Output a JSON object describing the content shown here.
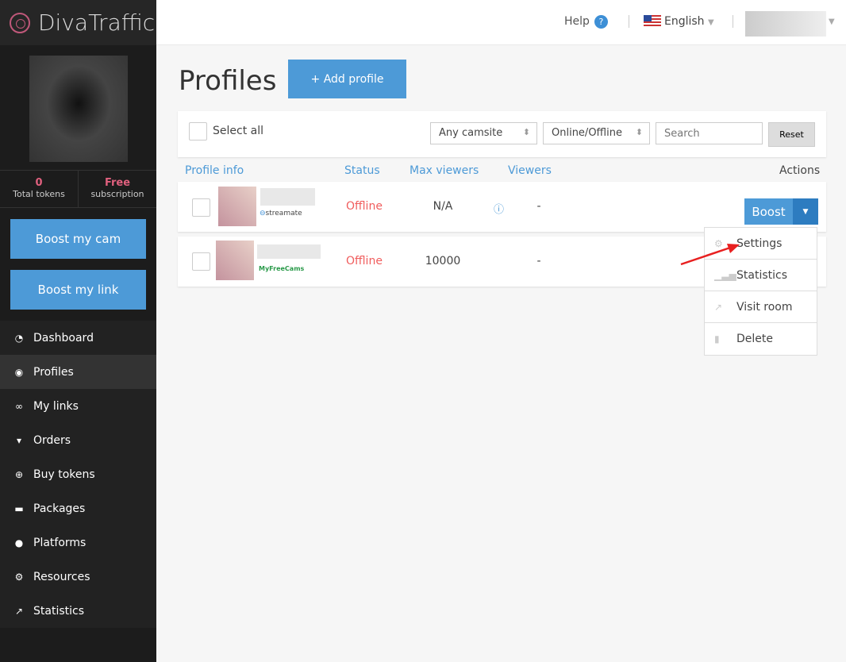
{
  "brand": "DivaTraffic",
  "sidebar": {
    "tokens": "0",
    "tokens_label": "Total tokens",
    "subscription": "Free",
    "subscription_label": "subscription",
    "boost_cam": "Boost my cam",
    "boost_link": "Boost my link",
    "items": [
      {
        "label": "Dashboard",
        "icon": "dashboard-icon"
      },
      {
        "label": "Profiles",
        "icon": "profile-icon"
      },
      {
        "label": "My links",
        "icon": "link-icon"
      },
      {
        "label": "Orders",
        "icon": "cart-icon"
      },
      {
        "label": "Buy tokens",
        "icon": "lifebuoy-icon"
      },
      {
        "label": "Packages",
        "icon": "car-icon"
      },
      {
        "label": "Platforms",
        "icon": "globe-icon"
      },
      {
        "label": "Resources",
        "icon": "gears-icon"
      },
      {
        "label": "Statistics",
        "icon": "chart-icon"
      }
    ]
  },
  "header": {
    "help": "Help",
    "language": "English"
  },
  "page": {
    "title": "Profiles",
    "add_profile": "+ Add profile"
  },
  "filters": {
    "select_all": "Select all",
    "camsite": "Any camsite",
    "status": "Online/Offline",
    "search_placeholder": "Search",
    "reset": "Reset"
  },
  "table": {
    "headers": [
      "Profile info",
      "Status",
      "Max viewers",
      "Viewers",
      "Actions"
    ],
    "rows": [
      {
        "site": "streamate",
        "status": "Offline",
        "max_viewers": "N/A",
        "viewers": "-"
      },
      {
        "site": "MyFreeCams",
        "status": "Offline",
        "max_viewers": "10000",
        "viewers": "-"
      }
    ]
  },
  "boost_label": "Boost",
  "menu": [
    "Settings",
    "Statistics",
    "Visit room",
    "Delete"
  ],
  "colors": {
    "accent": "#4d9ad7",
    "offline": "#f05d5d",
    "brand": "#c0587a"
  }
}
